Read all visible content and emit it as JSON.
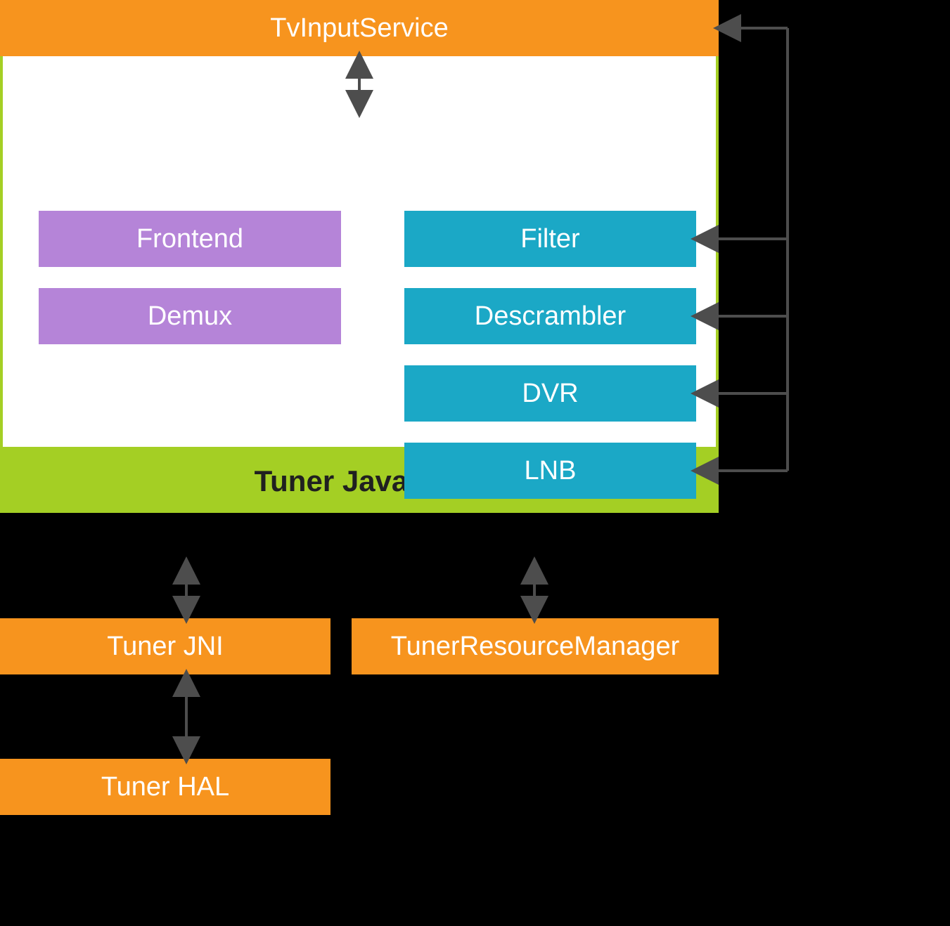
{
  "nodes": {
    "tv_input_service": "TvInputService",
    "tuner_java_api": "Tuner Java API",
    "frontend": "Frontend",
    "demux": "Demux",
    "filter": "Filter",
    "descrambler": "Descrambler",
    "dvr": "DVR",
    "lnb": "LNB",
    "tuner_jni": "Tuner JNI",
    "tuner_resource_manager": "TunerResourceManager",
    "tuner_hal": "Tuner HAL"
  },
  "colors": {
    "orange": "#f7941e",
    "green": "#a4cf24",
    "purple": "#b584d8",
    "cyan": "#1ba8c6",
    "arrow": "#4d4d4d"
  },
  "edges_bidirectional": [
    [
      "TvInputService",
      "Tuner Java API"
    ],
    [
      "Tuner Java API",
      "Tuner JNI"
    ],
    [
      "Tuner Java API",
      "TunerResourceManager"
    ],
    [
      "Tuner JNI",
      "Tuner HAL"
    ]
  ],
  "edges_right_bus_targets": [
    "TvInputService",
    "Filter",
    "Descrambler",
    "DVR",
    "LNB"
  ]
}
